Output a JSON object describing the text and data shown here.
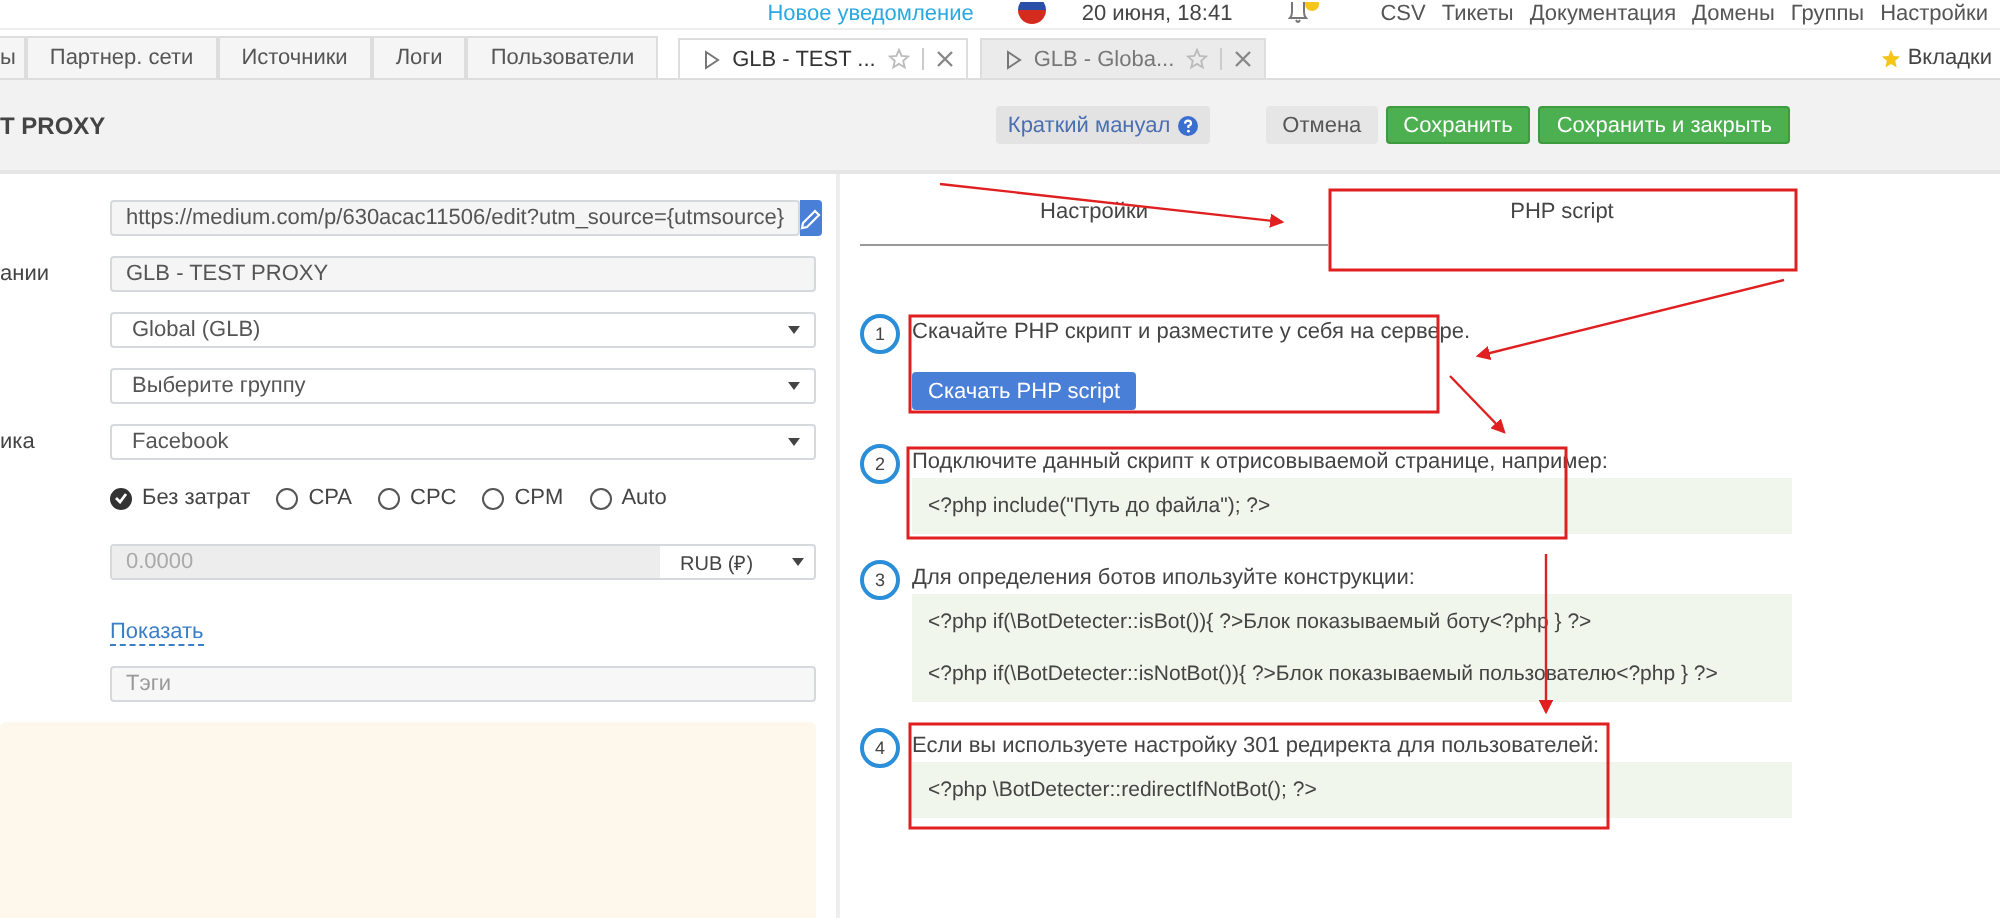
{
  "top_bar": {
    "notification_link": "Новое уведомление",
    "date": "20 июня, 18:41",
    "menu": [
      "CSV",
      "Тикеты",
      "Документация",
      "Домены",
      "Группы",
      "Настройки"
    ]
  },
  "tabs": [
    {
      "label": "ы"
    },
    {
      "label": "Партнер. сети"
    },
    {
      "label": "Источники"
    },
    {
      "label": "Логи"
    },
    {
      "label": "Пользователи"
    }
  ],
  "open_tabs": [
    {
      "label": "GLB - TEST ...",
      "selected": true
    },
    {
      "label": "GLB - Globa...",
      "selected": false
    }
  ],
  "bookmarks_label": "Вкладки",
  "header": {
    "title": "T PROXY",
    "manual_button": "Краткий мануал",
    "buttons": [
      {
        "kind": "cancel",
        "label": "Отмена"
      },
      {
        "kind": "primary",
        "label": "Сохранить"
      },
      {
        "kind": "primary",
        "label": "Сохранить и закрыть"
      }
    ]
  },
  "form": [
    {
      "kind": "url",
      "value": "https://medium.com/p/630acac11506/edit?utm_source={utmsource}"
    },
    {
      "kind": "text",
      "label": "ании",
      "value": "GLB - TEST PROXY"
    },
    {
      "kind": "select",
      "value": "Global (GLB)"
    },
    {
      "kind": "select",
      "value": "Выберите группу"
    },
    {
      "kind": "select",
      "label": "ика",
      "value": "Facebook"
    },
    {
      "kind": "radio",
      "options": [
        {
          "label": "Без затрат",
          "selected": true
        },
        {
          "label": "CPA",
          "selected": false
        },
        {
          "label": "CPC",
          "selected": false
        },
        {
          "label": "CPM",
          "selected": false
        },
        {
          "label": "Auto",
          "selected": false
        }
      ]
    },
    {
      "kind": "amount",
      "value": "0.0000",
      "currency": "RUB (₽)"
    },
    {
      "kind": "link",
      "text": "Показать"
    },
    {
      "kind": "tags",
      "placeholder": "Тэги"
    }
  ],
  "script_panel": {
    "tabs": [
      {
        "label": "Настройки",
        "selected": false
      },
      {
        "label": "PHP script",
        "selected": true
      }
    ],
    "steps": [
      {
        "number": "1",
        "text": "Скачайте PHP скрипт и разместите у себя на сервере.",
        "button": "Скачать PHP script"
      },
      {
        "number": "2",
        "text": "Подключите данный скрипт к отрисовываемой странице, например:",
        "code": [
          "<?php include(\"Путь до файла\"); ?>"
        ]
      },
      {
        "number": "3",
        "text": "Для определения ботов ипользуйте конструкции:",
        "code": [
          "<?php if(\\BotDetecter::isBot()){ ?>Блок показываемый боту<?php } ?>",
          "<?php if(\\BotDetecter::isNotBot()){ ?>Блок показываемый пользователю<?php } ?>"
        ]
      },
      {
        "number": "4",
        "text": "Если вы используете настройку 301 редиректа для пользователей:",
        "code": [
          "<?php \\BotDetecter::redirectIfNotBot(); ?>"
        ]
      }
    ]
  }
}
